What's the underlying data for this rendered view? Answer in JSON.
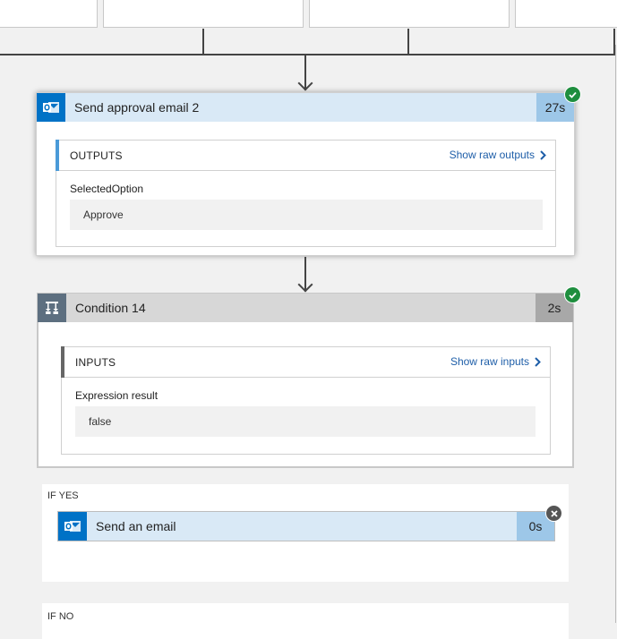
{
  "colors": {
    "outlook_blue": "#0072c6",
    "selected_header_bg": "#d9e9f6",
    "selected_duration_bg": "#9dc7e8",
    "condition_icon_bg": "#5d6f80",
    "condition_header_bg": "#d7d7d7",
    "condition_duration_bg": "#a8a8a8",
    "success_green": "#1e8e3e",
    "skipped_gray": "#555555",
    "link_blue": "#1e5ea8",
    "outputs_accent": "#4a9ad8",
    "inputs_accent": "#666666"
  },
  "actions": [
    {
      "title": "Send approval email 2",
      "icon": "outlook-icon",
      "duration": "27s",
      "status": "succeeded",
      "status_icon": "check-icon",
      "section": {
        "title": "OUTPUTS",
        "link_label": "Show raw outputs",
        "fields": [
          {
            "label": "SelectedOption",
            "value": "Approve"
          }
        ]
      }
    },
    {
      "title": "Condition 14",
      "icon": "condition-icon",
      "duration": "2s",
      "status": "succeeded",
      "status_icon": "check-icon",
      "section": {
        "title": "INPUTS",
        "link_label": "Show raw inputs",
        "fields": [
          {
            "label": "Expression result",
            "value": "false"
          }
        ]
      }
    }
  ],
  "branches": {
    "yes": {
      "label": "IF YES",
      "actions": [
        {
          "title": "Send an email",
          "icon": "outlook-icon",
          "duration": "0s",
          "status": "skipped",
          "status_icon": "close-icon"
        }
      ]
    },
    "no": {
      "label": "IF NO"
    }
  }
}
